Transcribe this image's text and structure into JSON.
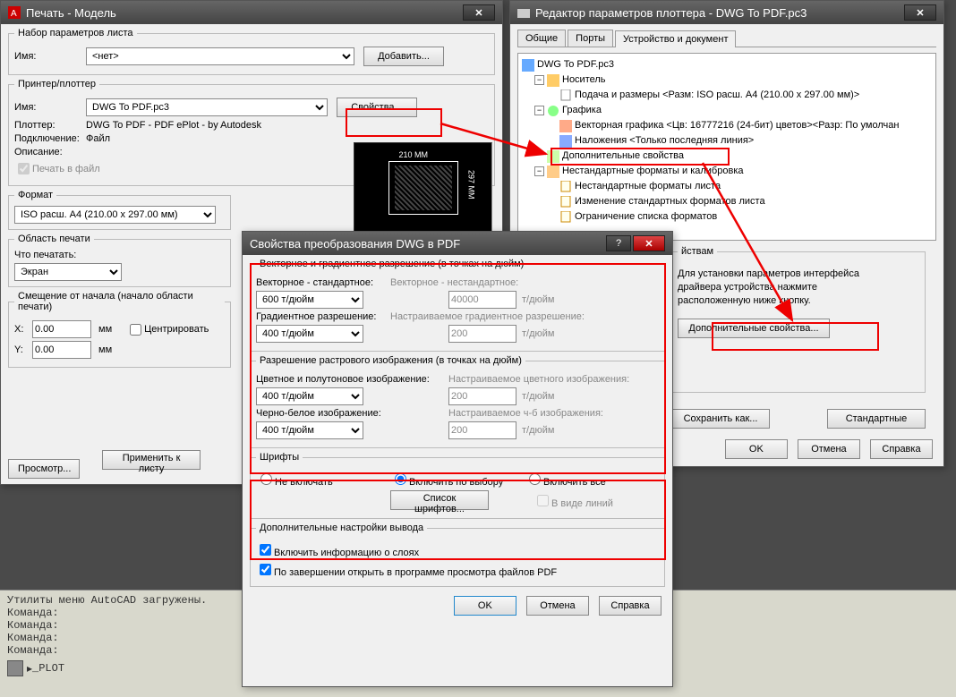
{
  "print_dialog": {
    "title": "Печать - Модель",
    "page_set": {
      "legend": "Набор параметров листа",
      "name_lbl": "Имя:",
      "name_val": "<нет>",
      "add_btn": "Добавить..."
    },
    "printer": {
      "legend": "Принтер/плоттер",
      "name_lbl": "Имя:",
      "name_val": "DWG To PDF.pc3",
      "props_btn": "Свойства...",
      "plotter_lbl": "Плоттер:",
      "plotter_val": "DWG To PDF - PDF ePlot - by Autodesk",
      "conn_lbl": "Подключение:",
      "conn_val": "Файл",
      "desc_lbl": "Описание:",
      "tofile_lbl": "Печать в файл"
    },
    "format": {
      "legend": "Формат",
      "val": "ISO расш. A4 (210.00 x 297.00 мм)"
    },
    "area": {
      "legend": "Область печати",
      "what_lbl": "Что печатать:",
      "what_val": "Экран"
    },
    "offset": {
      "legend": "Смещение от начала (начало области печати)",
      "x_lbl": "X:",
      "x_val": "0.00",
      "y_lbl": "Y:",
      "y_val": "0.00",
      "unit": "мм",
      "center_lbl": "Центрировать"
    },
    "preview_btn": "Просмотр...",
    "apply_btn": "Применить к листу",
    "preview_dim1": "210 MM",
    "preview_dim2": "297 MM"
  },
  "plotter_editor": {
    "title": "Редактор параметров плоттера - DWG To PDF.pc3",
    "tabs": [
      "Общие",
      "Порты",
      "Устройство и документ"
    ],
    "tree": {
      "root": "DWG To PDF.pc3",
      "media": "Носитель",
      "media_src": "Подача и размеры <Разм: ISO расш. A4 (210.00 x 297.00 мм)>",
      "graphics": "Графика",
      "vector": "Векторная графика <Цв: 16777216 (24-бит) цветов><Разр: По умолчан",
      "merge": "Наложения <Только последняя линия>",
      "custom": "Дополнительные свойства",
      "nonstandard": "Нестандартные форматы и калибровка",
      "nsf": "Нестандартные форматы листа",
      "chg": "Изменение стандартных форматов листа",
      "limit": "Ограничение списка форматов"
    },
    "custom_fs": "йствам",
    "custom_text1": "Для установки параметров интерфейса",
    "custom_text2": "драйвера устройства нажмите",
    "custom_text3": "расположенную ниже кнопку.",
    "custom_btn": "Дополнительные свойства...",
    "save_btn": "Сохранить как...",
    "std_btn": "Стандартные",
    "ok": "OK",
    "cancel": "Отмена",
    "help": "Справка"
  },
  "dwg_pdf": {
    "title": "Свойства преобразования DWG в PDF",
    "vec_fs": "Векторное и градиентное разрешение (в точках на дюйм)",
    "vec_std_lbl": "Векторное - стандартное:",
    "vec_std_val": "600 т/дюйм",
    "vec_ns_lbl": "Векторное - нестандартное:",
    "vec_ns_val": "40000",
    "vec_ns_unit": "т/дюйм",
    "grad_lbl": "Градиентное разрешение:",
    "grad_val": "400 т/дюйм",
    "grad_ns_lbl": "Настраиваемое градиентное разрешение:",
    "grad_ns_val": "200",
    "grad_ns_unit": "т/дюйм",
    "rast_fs": "Разрешение растрового изображения (в точках на дюйм)",
    "color_lbl": "Цветное и полутоновое изображение:",
    "color_val": "400 т/дюйм",
    "color_ns_lbl": "Настраиваемое цветного изображения:",
    "color_ns_val": "200",
    "color_ns_unit": "т/дюйм",
    "bw_lbl": "Черно-белое изображение:",
    "bw_val": "400 т/дюйм",
    "bw_ns_lbl": "Настраиваемое ч-б изображения:",
    "bw_ns_val": "200",
    "bw_ns_unit": "т/дюйм",
    "fonts_fs": "Шрифты",
    "f_none": "Не включать",
    "f_sel": "Включить по выбору",
    "f_all": "Включить все",
    "font_list_btn": "Список шрифтов...",
    "as_lines": "В виде линий",
    "extra_fs": "Дополнительные настройки вывода",
    "layers_chk": "Включить информацию о слоях",
    "open_chk": "По завершении открыть в программе просмотра файлов PDF",
    "ok": "OK",
    "cancel": "Отмена",
    "help": "Справка"
  },
  "console": {
    "l1": "Утилиты меню AutoCAD загружены.",
    "l2": "Команда:",
    "cmd": "_PLOT"
  }
}
